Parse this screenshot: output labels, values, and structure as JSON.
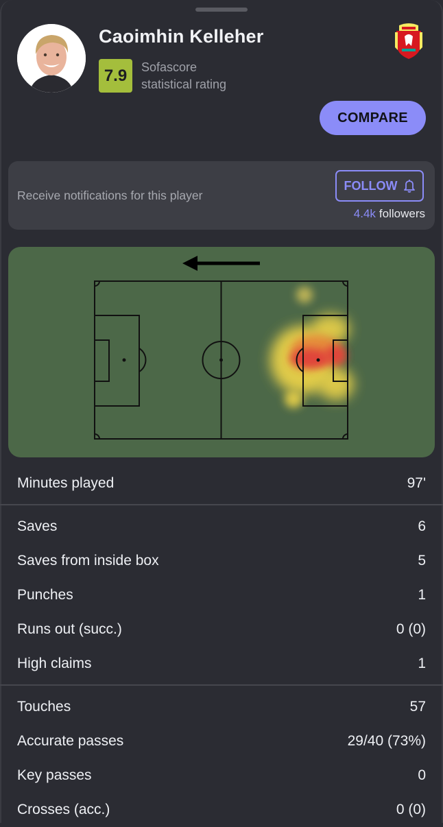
{
  "player": {
    "name": "Caoimhin Kelleher",
    "rating": "7.9",
    "rating_label_line1": "Sofascore",
    "rating_label_line2": "statistical rating",
    "photo_icon": "player-photo",
    "club_icon": "liverpool-crest-icon"
  },
  "actions": {
    "compare_label": "COMPARE"
  },
  "notifications": {
    "text": "Receive notifications for this player",
    "follow_label": "FOLLOW",
    "follow_icon": "bell-icon",
    "followers_count": "4.4k",
    "followers_label": "followers"
  },
  "heatmap": {
    "attack_direction": "left",
    "direction_icon": "arrow-left-icon"
  },
  "stats": {
    "group1": [
      {
        "label": "Minutes played",
        "value": "97'"
      }
    ],
    "group2": [
      {
        "label": "Saves",
        "value": "6"
      },
      {
        "label": "Saves from inside box",
        "value": "5"
      },
      {
        "label": "Punches",
        "value": "1"
      },
      {
        "label": "Runs out (succ.)",
        "value": "0 (0)"
      },
      {
        "label": "High claims",
        "value": "1"
      }
    ],
    "group3": [
      {
        "label": "Touches",
        "value": "57"
      },
      {
        "label": "Accurate passes",
        "value": "29/40 (73%)"
      },
      {
        "label": "Key passes",
        "value": "0"
      },
      {
        "label": "Crosses (acc.)",
        "value": "0 (0)"
      }
    ]
  },
  "colors": {
    "accent": "#8b8cf8",
    "rating_bg": "#a4be3c",
    "background": "#2b2c33",
    "card_bg": "#3d3e45",
    "pitch": "#4c6848"
  }
}
